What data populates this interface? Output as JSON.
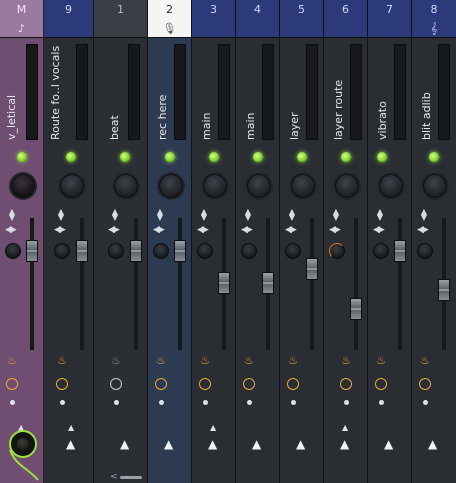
{
  "mixer": {
    "strips": [
      {
        "id": "master",
        "number": "M",
        "name": "v_letical",
        "header_icon": "♪",
        "icon_name": "note-icon"
      },
      {
        "id": "9",
        "number": "9",
        "name": "Route fo..l vocals"
      },
      {
        "id": "1",
        "number": "1",
        "name": "beat"
      },
      {
        "id": "2",
        "number": "2",
        "name": "rec here",
        "header_icon": "🎙",
        "icon_name": "microphone-icon"
      },
      {
        "id": "3",
        "number": "3",
        "name": "main"
      },
      {
        "id": "4",
        "number": "4",
        "name": "main"
      },
      {
        "id": "5",
        "number": "5",
        "name": "layer"
      },
      {
        "id": "6",
        "number": "6",
        "name": "layer route"
      },
      {
        "id": "7",
        "number": "7",
        "name": "vibrato"
      },
      {
        "id": "8",
        "number": "8",
        "name": "blit adlib",
        "header_icon": "𝄞",
        "icon_name": "treble-clef-icon"
      }
    ],
    "bottom_label": "<",
    "colors": {
      "insert_header": "#2c3a7a",
      "master_strip": "#6f4e72",
      "selected_header": "#f5f5f5",
      "led_green": "#7ccf2a",
      "fx_orange": "#f0a53a"
    }
  }
}
